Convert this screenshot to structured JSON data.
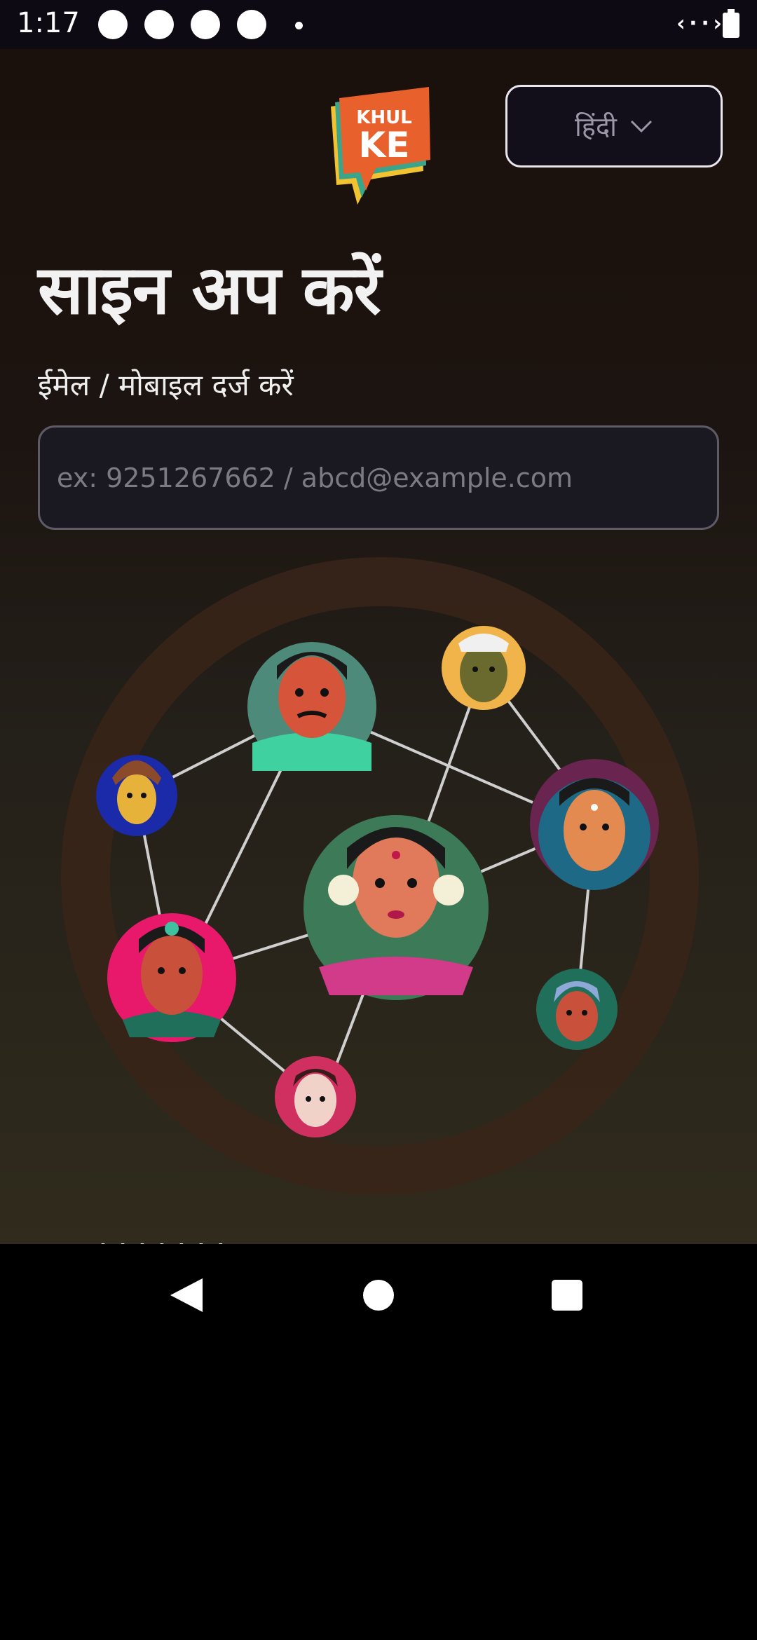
{
  "status_bar": {
    "time": "1:17"
  },
  "header": {
    "logo_text_line1": "KHUL",
    "logo_text_line2": "KE",
    "language_label": "हिंदी"
  },
  "signup": {
    "title": "साइन अप करें",
    "field_label": "ईमेल / मोबाइल दर्ज करें",
    "input_value": "",
    "input_placeholder": "ex: 9251267662 / abcd@example.com"
  },
  "icons": {
    "language_chevron": "chevron-down-icon",
    "nav_back": "back-triangle-icon",
    "nav_home": "home-circle-icon",
    "nav_recent": "recent-square-icon"
  },
  "colors": {
    "logo_orange": "#e8612c",
    "logo_yellow": "#f2c230",
    "logo_green": "#3aa58a",
    "ring": "#3a2419"
  }
}
